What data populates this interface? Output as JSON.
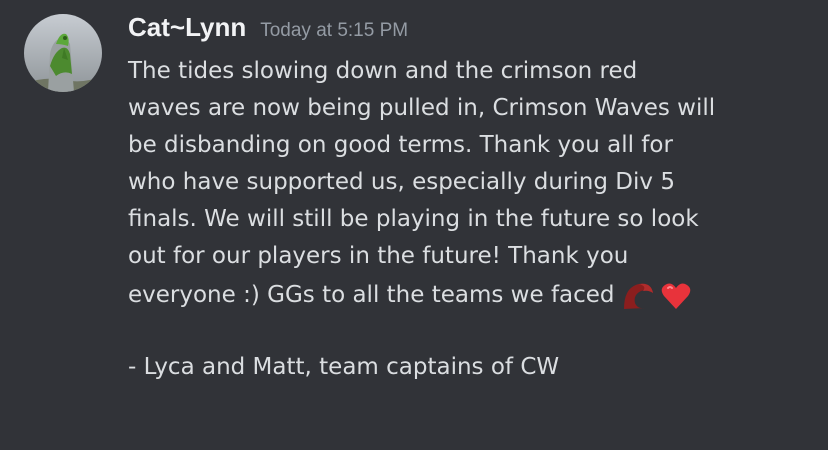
{
  "message": {
    "author": "Cat~Lynn",
    "timestamp": "Today at 5:15 PM",
    "lines": [
      "The tides slowing down and the crimson red",
      "waves are now being pulled in, Crimson Waves will",
      "be disbanding on good terms. Thank you all for",
      "who have supported us, especially during Div 5",
      "finals. We will still be playing in the future so look",
      "out for our players in the future! Thank you",
      "everyone :) GGs to all the teams we faced",
      "",
      "- Lyca and Matt, team captains of CW"
    ],
    "emojis": [
      "crimson-wave-emoji",
      "red-heart-emoji"
    ]
  },
  "colors": {
    "background": "#313338",
    "author": "#f2f3f5",
    "timestamp": "#949ba4",
    "text": "#dbdee1",
    "crimson": "#8b1e1e",
    "heart": "#e8333b"
  }
}
